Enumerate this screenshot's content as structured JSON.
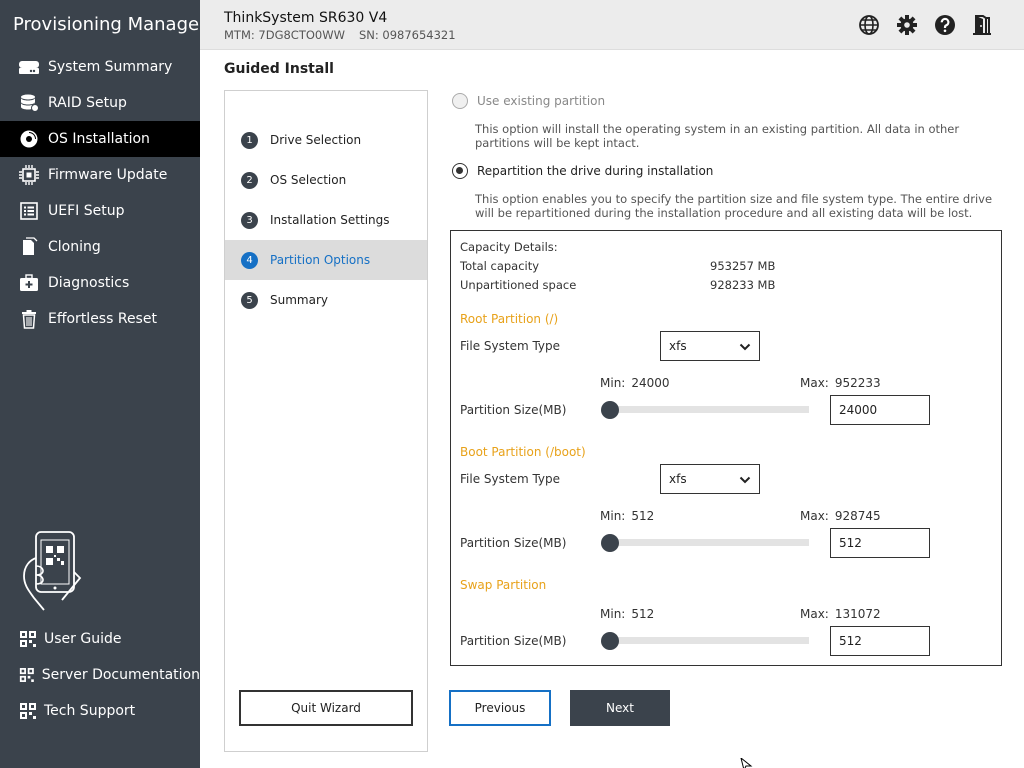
{
  "app": {
    "title": "Provisioning Manager"
  },
  "sidebar": {
    "items": [
      {
        "label": "System Summary",
        "icon": "server-icon"
      },
      {
        "label": "RAID Setup",
        "icon": "database-icon"
      },
      {
        "label": "OS Installation",
        "icon": "disc-icon",
        "active": true
      },
      {
        "label": "Firmware Update",
        "icon": "chip-icon"
      },
      {
        "label": "UEFI Setup",
        "icon": "list-icon"
      },
      {
        "label": "Cloning",
        "icon": "copy-icon"
      },
      {
        "label": "Diagnostics",
        "icon": "medkit-icon"
      },
      {
        "label": "Effortless Reset",
        "icon": "trash-icon"
      }
    ],
    "links": [
      {
        "label": "User Guide",
        "icon": "qr-icon"
      },
      {
        "label": "Server Documentation",
        "icon": "qr-icon"
      },
      {
        "label": "Tech Support",
        "icon": "qr-icon"
      }
    ]
  },
  "header": {
    "model": "ThinkSystem SR630 V4",
    "mtm": "MTM: 7DG8CTO0WW",
    "sn": "SN: 0987654321",
    "icons": [
      "globe-icon",
      "gear-icon",
      "help-icon",
      "exit-icon"
    ]
  },
  "main": {
    "title": "Guided Install",
    "steps": [
      {
        "num": "1",
        "label": "Drive Selection"
      },
      {
        "num": "2",
        "label": "OS Selection"
      },
      {
        "num": "3",
        "label": "Installation Settings"
      },
      {
        "num": "4",
        "label": "Partition Options",
        "active": true
      },
      {
        "num": "5",
        "label": "Summary"
      }
    ],
    "quit_label": "Quit Wizard",
    "options": {
      "existing": {
        "label": "Use existing partition",
        "desc": "This option will install the operating system in an existing partition. All data in other partitions will be kept intact.",
        "selected": false,
        "disabled": true
      },
      "repartition": {
        "label": "Repartition the drive during installation",
        "desc": "This option enables you to specify the partition size and file system type. The entire drive will be repartitioned during the installation procedure and all existing data will be lost.",
        "selected": true
      }
    },
    "capacity": {
      "heading": "Capacity Details:",
      "total_label": "Total capacity",
      "total_value": "953257 MB",
      "unpart_label": "Unpartitioned space",
      "unpart_value": "928233 MB"
    },
    "root": {
      "title": "Root Partition (/)",
      "fs_label": "File System Type",
      "fs_value": "xfs",
      "min_label": "Min:",
      "min_value": "24000",
      "max_label": "Max:",
      "max_value": "952233",
      "size_label": "Partition Size(MB)",
      "size_value": "24000"
    },
    "boot": {
      "title": "Boot Partition (/boot)",
      "fs_label": "File System Type",
      "fs_value": "xfs",
      "min_label": "Min:",
      "min_value": "512",
      "max_label": "Max:",
      "max_value": "928745",
      "size_label": "Partition Size(MB)",
      "size_value": "512"
    },
    "swap": {
      "title": "Swap Partition",
      "min_label": "Min:",
      "min_value": "512",
      "max_label": "Max:",
      "max_value": "131072",
      "size_label": "Partition Size(MB)",
      "size_value": "512"
    },
    "buttons": {
      "previous": "Previous",
      "next": "Next"
    }
  },
  "colors": {
    "sidebar_bg": "#3b434c",
    "active_nav": "#000000",
    "accent_blue": "#1570c5",
    "section_orange": "#e8a21a"
  }
}
